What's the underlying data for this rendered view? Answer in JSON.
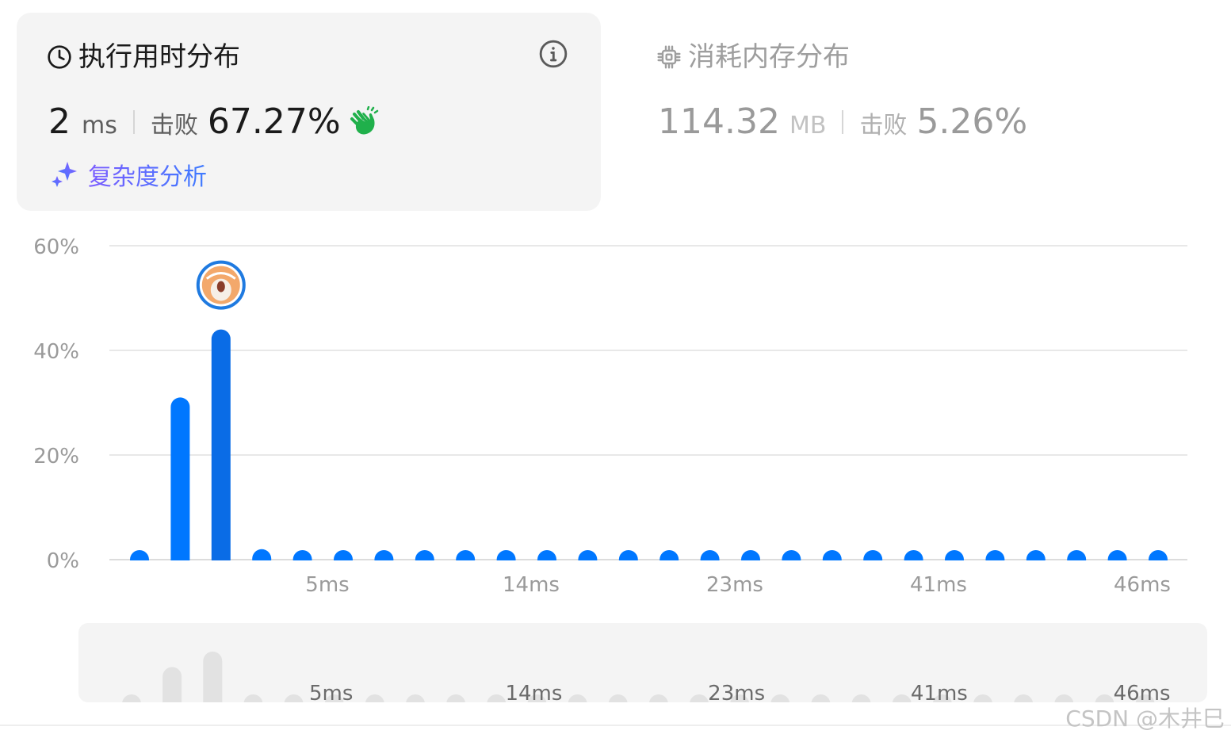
{
  "runtime": {
    "title": "执行用时分布",
    "value": "2",
    "unit": "ms",
    "beat_label": "击败",
    "beat_pct": "67.27%",
    "complexity_link": "复杂度分析"
  },
  "memory": {
    "title": "消耗内存分布",
    "value": "114.32",
    "unit": "MB",
    "beat_label": "击败",
    "beat_pct": "5.26%"
  },
  "colors": {
    "bar": "#0077ff",
    "bar_active": "#0a6ce6",
    "brush_bar": "#e2e2e2",
    "grid": "#e8e8e8",
    "axis_text": "#9a9a9a",
    "clap": "#20b04b",
    "avatar_ring": "#1f7ae0"
  },
  "icons": {
    "title": "clock-icon",
    "info": "info-icon",
    "clap": "clapping-hands-icon",
    "sparkle": "sparkle-icon",
    "memory": "chip-icon",
    "marker": "power-avatar-icon"
  },
  "chart_data": {
    "type": "bar",
    "xlabel": "",
    "ylabel": "",
    "ylim": [
      0,
      60
    ],
    "y_ticks": [
      "0%",
      "20%",
      "40%",
      "60%"
    ],
    "y_tick_values": [
      0,
      20,
      40,
      60
    ],
    "x_tick_labels": [
      {
        "index": 5,
        "label": "5ms"
      },
      {
        "index": 10,
        "label": "14ms"
      },
      {
        "index": 15,
        "label": "23ms"
      },
      {
        "index": 20,
        "label": "41ms"
      },
      {
        "index": 25,
        "label": "46ms"
      }
    ],
    "values": [
      1,
      31,
      44,
      2,
      1,
      1,
      1,
      1,
      1,
      1,
      1,
      1,
      1,
      1,
      1,
      1,
      1,
      1,
      1,
      1,
      1,
      1,
      1,
      1,
      1,
      1
    ],
    "highlight_index": 2,
    "grid": true,
    "legend": "none"
  },
  "brush": {
    "x_tick_labels": [
      "5ms",
      "14ms",
      "23ms",
      "41ms",
      "46ms"
    ]
  },
  "watermark": "CSDN @木井巳"
}
